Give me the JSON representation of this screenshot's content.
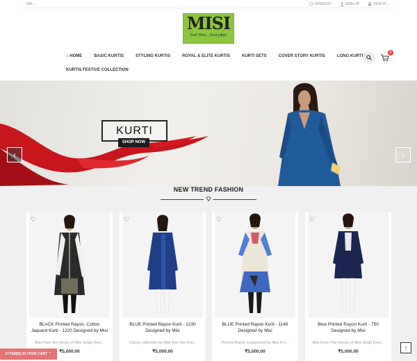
{
  "topbar": {
    "currency": "INR",
    "wishlist": "WISHLIST",
    "signup": "SIGN UP",
    "signin": "SIGN IN"
  },
  "logo": {
    "brand": "MISI",
    "tagline": "Feel New... Everyday!"
  },
  "nav": {
    "items": [
      {
        "label": "HOME"
      },
      {
        "label": "BASIC KURTIS"
      },
      {
        "label": "STYLING KURTIS"
      },
      {
        "label": "ROYAL & ELITE KURTIS"
      },
      {
        "label": "KURTI SETS"
      },
      {
        "label": "COVER STORY KURTIS"
      },
      {
        "label": "LONG KURTIS"
      }
    ],
    "second_row": "KURTIS FESTIVE COLLECTION",
    "cart_count": "0"
  },
  "hero": {
    "title": "KURTI",
    "button": "SHOP NOW",
    "prev": "‹",
    "next": "›"
  },
  "section": {
    "title": "NEW TREND FASHION"
  },
  "products": [
    {
      "name": "BLACK Printed Rayon, Cotton Jaquard Kurti - 1220 Designed by Misi",
      "desc": "Misi From the house of Mini Singh Desi...",
      "price": "₹5,000.00",
      "colors": {
        "top": "#2b2b2b",
        "accent": "#f2f0ea",
        "bottom": "#111111"
      }
    },
    {
      "name": "BLUE Printed Rayon Kurti - 1230 Designed by Misi",
      "desc": "Classy collection by Misi from the hou...",
      "price": "₹5,000.00",
      "colors": {
        "top": "#1f3f86",
        "accent": "#2c55a8",
        "bottom": "#f5f5f5"
      }
    },
    {
      "name": "BLUE Printed Rayon Kurti - 1146 Designed by Misi",
      "desc": "Printed Rayon customised by Misi Fro...",
      "price": "₹5,000.00",
      "colors": {
        "top": "#ece6d8",
        "accent": "#4f7fd6",
        "bottom": "#1a1a1a"
      }
    },
    {
      "name": "Blue Printed Rayon Kurti - 750 Designed by Misi",
      "desc": "Misi From The House of Mini Singh Desi...",
      "price": "₹5,000.00",
      "colors": {
        "top": "#1b2550",
        "accent": "#e9e9ef",
        "bottom": "#f4f4f4"
      }
    }
  ],
  "cart_bar": "0 ITEM(S) IN YOUR CART",
  "to_top": "↑"
}
